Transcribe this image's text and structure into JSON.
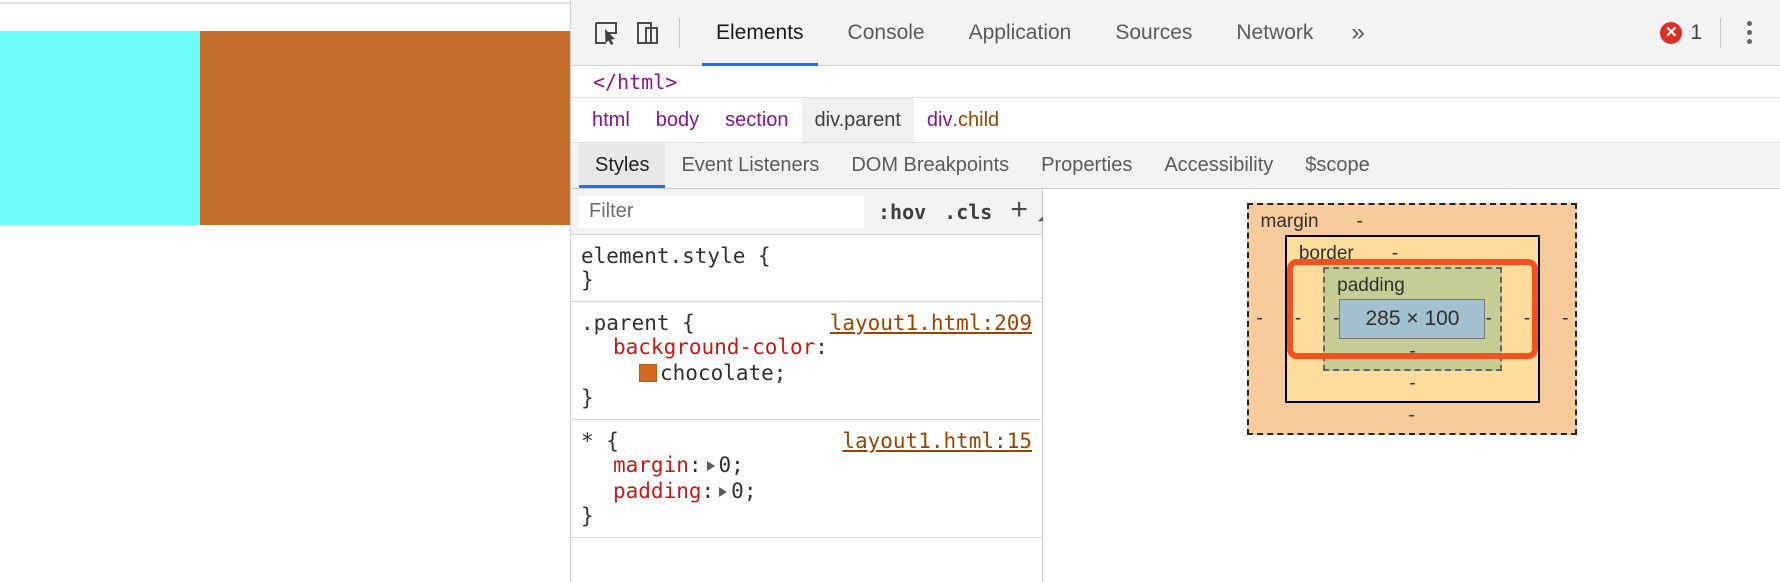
{
  "page_preview": {
    "cyan_block_color": "#6ffbfb",
    "chocolate_block_color": "#c4702c",
    "background": "#ffffff"
  },
  "toolbar": {
    "inspect_icon": "cursor-select-icon",
    "device_icon": "device-toggle-icon",
    "tabs": [
      {
        "label": "Elements",
        "active": true
      },
      {
        "label": "Console",
        "active": false
      },
      {
        "label": "Application",
        "active": false
      },
      {
        "label": "Sources",
        "active": false
      },
      {
        "label": "Network",
        "active": false
      }
    ],
    "more_tabs_label": "»",
    "error_count": "1",
    "error_color": "#d93025",
    "menu_icon": "kebab-menu-icon"
  },
  "dom_strip": {
    "line": "</html>"
  },
  "breadcrumb": [
    {
      "text": "html",
      "selected": false
    },
    {
      "text": "body",
      "selected": false
    },
    {
      "text": "section",
      "selected": false
    },
    {
      "text": "div.parent",
      "selected": true
    },
    {
      "text": "div",
      "suffix": ".child",
      "selected": false
    }
  ],
  "sub_tabs": [
    {
      "label": "Styles",
      "active": true
    },
    {
      "label": "Event Listeners",
      "active": false
    },
    {
      "label": "DOM Breakpoints",
      "active": false
    },
    {
      "label": "Properties",
      "active": false
    },
    {
      "label": "Accessibility",
      "active": false
    },
    {
      "label": "$scope",
      "active": false
    }
  ],
  "filter_bar": {
    "placeholder": "Filter",
    "value": "",
    "hov_label": ":hov",
    "cls_label": ".cls",
    "new_rule_label": "+"
  },
  "rules": [
    {
      "selector": "element.style {",
      "origin": "",
      "declarations": [],
      "close": "}"
    },
    {
      "selector": ".parent {",
      "origin": "layout1.html:209",
      "declarations": [
        {
          "property": "background-color",
          "value": "chocolate;",
          "swatch": "#d2691e",
          "expandable": false
        }
      ],
      "close": "}"
    },
    {
      "selector": "* {",
      "origin": "layout1.html:15",
      "declarations": [
        {
          "property": "margin",
          "value": "0;",
          "swatch": null,
          "expandable": true
        },
        {
          "property": "padding",
          "value": "0;",
          "swatch": null,
          "expandable": true
        }
      ],
      "close": "}"
    }
  ],
  "box_model": {
    "margin": {
      "label": "margin",
      "top": "-",
      "right": "-",
      "bottom": "-",
      "left": "-",
      "color": "#f8cb9c"
    },
    "border": {
      "label": "border",
      "top": "-",
      "right": "-",
      "bottom": "-",
      "left": "-",
      "color": "#fddc9c"
    },
    "padding": {
      "label": "padding",
      "top": "",
      "right": "-",
      "bottom": "-",
      "left": "-",
      "color": "#c5cd94"
    },
    "content": {
      "size": "285 × 100",
      "color": "#a3c0ce"
    },
    "highlight_color": "#f4511e"
  }
}
